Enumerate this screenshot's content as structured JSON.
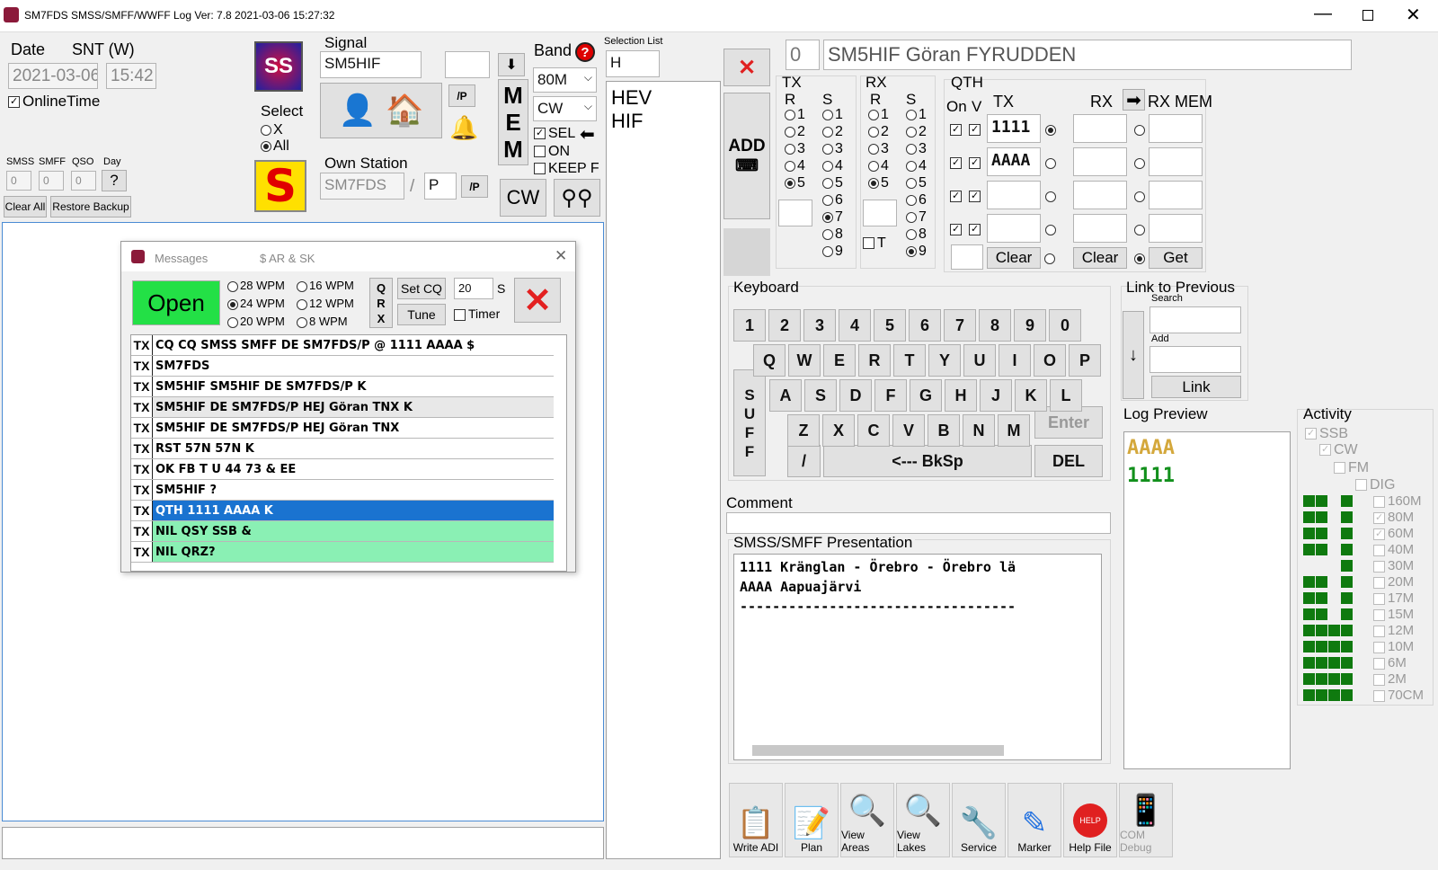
{
  "window": {
    "title": "SM7FDS SMSS/SMFF/WWFF Log Ver: 7.8 2021-03-06 15:27:32"
  },
  "datetime": {
    "date_label": "Date",
    "snt_label": "SNT (W)",
    "date": "2021-03-06",
    "time": "15:42",
    "online_time": "OnlineTime"
  },
  "counters": {
    "smss": "SMSS",
    "smff": "SMFF",
    "qso": "QSO",
    "day": "Day",
    "smss_val": "0",
    "smff_val": "0",
    "qso_val": "0",
    "day_btn": "?",
    "clear_all": "Clear All",
    "restore": "Restore Backup"
  },
  "logo": {
    "text": "SS",
    "s_text": "S"
  },
  "select": {
    "label": "Select",
    "x": "X",
    "all": "All"
  },
  "signal": {
    "label": "Signal",
    "value": "SM5HIF",
    "suffix": "",
    "p_btn": "/P"
  },
  "own": {
    "label": "Own Station",
    "value": "SM7FDS",
    "slash": "/",
    "suffix": "P",
    "p_btn": "/P"
  },
  "mem": {
    "letters": [
      "M",
      "E",
      "M"
    ]
  },
  "band": {
    "label": "Band",
    "band": "80M",
    "mode": "CW",
    "sel": "SEL",
    "on": "ON",
    "keep": "KEEP F",
    "cw": "CW"
  },
  "selection": {
    "label": "Selection List",
    "input": "H",
    "items": [
      "HEV",
      "HIF"
    ]
  },
  "station": {
    "count": "0",
    "info": "SM5HIF Göran  FYRUDDEN",
    "add": "ADD"
  },
  "tx": {
    "label": "TX",
    "r": "R",
    "s": "S",
    "r_opts": [
      "1",
      "2",
      "3",
      "4",
      "5"
    ],
    "s_opts": [
      "1",
      "2",
      "3",
      "4",
      "5",
      "6",
      "7",
      "8",
      "9"
    ]
  },
  "rx": {
    "label": "RX",
    "r": "R",
    "s": "S",
    "r_opts": [
      "1",
      "2",
      "3",
      "4",
      "5"
    ],
    "s_opts": [
      "1",
      "2",
      "3",
      "4",
      "5",
      "6",
      "7",
      "8",
      "9"
    ],
    "t": "T"
  },
  "qth": {
    "label": "QTH",
    "on": "On",
    "v": "V",
    "tx": "TX",
    "rx": "RX",
    "rxmem": "RX MEM",
    "tx_vals": [
      "1111",
      "AAAA",
      "",
      ""
    ],
    "clear1": "Clear",
    "clear2": "Clear",
    "get": "Get"
  },
  "keyboard": {
    "label": "Keyboard",
    "row1": [
      "1",
      "2",
      "3",
      "4",
      "5",
      "6",
      "7",
      "8",
      "9",
      "0"
    ],
    "row2": [
      "Q",
      "W",
      "E",
      "R",
      "T",
      "Y",
      "U",
      "I",
      "O",
      "P"
    ],
    "row3": [
      "A",
      "S",
      "D",
      "F",
      "G",
      "H",
      "J",
      "K",
      "L"
    ],
    "row4": [
      "Z",
      "X",
      "C",
      "V",
      "B",
      "N",
      "M"
    ],
    "suff": [
      "S",
      "U",
      "F",
      "F"
    ],
    "enter": "Enter",
    "slash": "/",
    "bksp": "<--- BkSp",
    "del": "DEL"
  },
  "link": {
    "label": "Link to Previous",
    "search": "Search",
    "add": "Add",
    "link": "Link"
  },
  "preview": {
    "label": "Log Preview",
    "lines": [
      "AAAA",
      "1111"
    ]
  },
  "activity": {
    "label": "Activity",
    "modes": [
      "SSB",
      "CW",
      "FM",
      "DIG"
    ],
    "bands": [
      "160M",
      "80M",
      "60M",
      "40M",
      "30M",
      "20M",
      "17M",
      "15M",
      "12M",
      "10M",
      "6M",
      "2M",
      "70CM"
    ]
  },
  "comment": {
    "label": "Comment",
    "value": ""
  },
  "presentation": {
    "label": "SMSS/SMFF Presentation",
    "lines": [
      "1111 Kränglan - Örebro - Örebro lä",
      "AAAA Aapuajärvi",
      "----------------------------------"
    ]
  },
  "toolbar": {
    "write_adi": "Write ADI",
    "plan": "Plan",
    "view_areas": "View Areas",
    "view_lakes": "View Lakes",
    "service": "Service",
    "marker": "Marker",
    "help": "Help File",
    "com": "COM Debug"
  },
  "messages": {
    "title": "Messages",
    "sub": "$ AR  & SK",
    "open": "Open",
    "wpm": [
      "28 WPM",
      "24 WPM",
      "20 WPM",
      "16 WPM",
      "12 WPM",
      "8 WPM"
    ],
    "qrx": [
      "Q",
      "R",
      "X"
    ],
    "set_cq": "Set CQ",
    "tune": "Tune",
    "secs": "20",
    "s": "S",
    "timer": "Timer",
    "rows": [
      {
        "tx": "TX",
        "text": "CQ CQ SMSS SMFF DE SM7FDS/P @ 1111 AAAA $"
      },
      {
        "tx": "TX",
        "text": "SM7FDS"
      },
      {
        "tx": "TX",
        "text": "SM5HIF SM5HIF DE SM7FDS/P K"
      },
      {
        "tx": "TX",
        "text": "SM5HIF DE SM7FDS/P HEJ Göran TNX K"
      },
      {
        "tx": "TX",
        "text": "SM5HIF DE SM7FDS/P HEJ Göran TNX"
      },
      {
        "tx": "TX",
        "text": "RST 57N 57N K"
      },
      {
        "tx": "TX",
        "text": "OK FB T U 44 73 & EE"
      },
      {
        "tx": "TX",
        "text": "SM5HIF ?"
      },
      {
        "tx": "TX",
        "text": "QTH 1111 AAAA K"
      },
      {
        "tx": "TX",
        "text": "NIL QSY SSB &"
      },
      {
        "tx": "TX",
        "text": "NIL QRZ?"
      }
    ]
  }
}
